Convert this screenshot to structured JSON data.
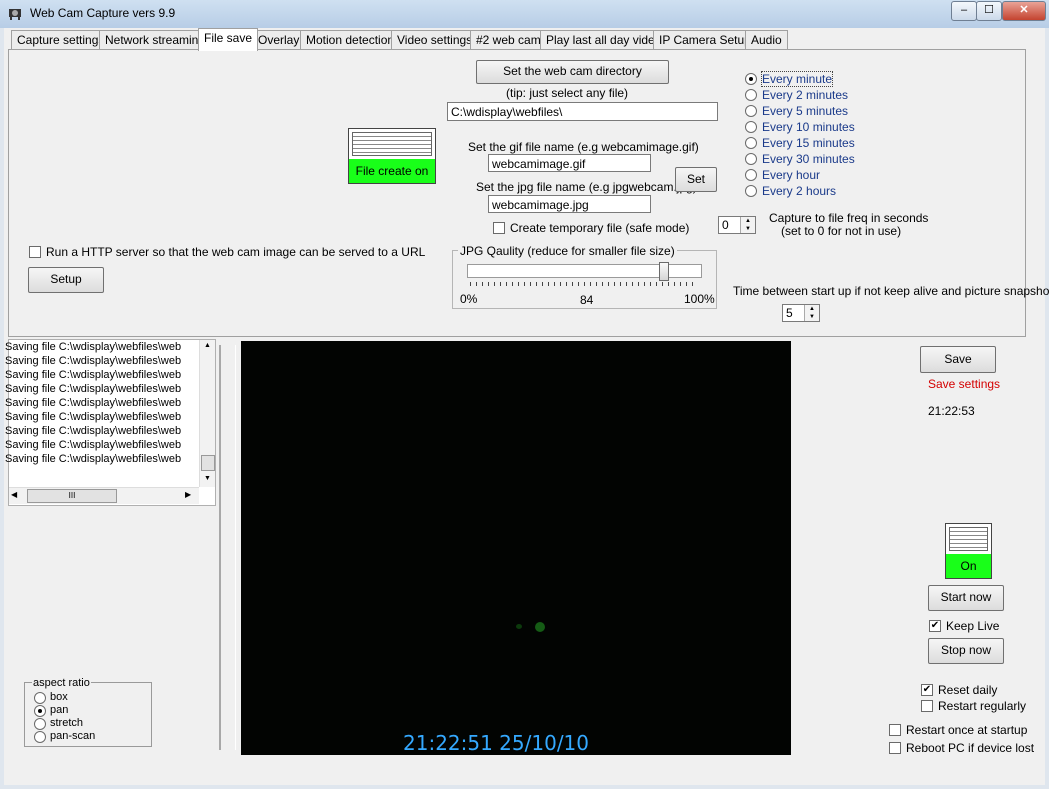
{
  "window": {
    "title": "Web Cam Capture vers 9.9",
    "controls": {
      "min": "–",
      "max": "☐",
      "close": "✕"
    }
  },
  "tabs": [
    {
      "label": "Capture settings"
    },
    {
      "label": "Network streaming"
    },
    {
      "label": "File save",
      "active": true
    },
    {
      "label": "Overlay"
    },
    {
      "label": "Motion detection"
    },
    {
      "label": "Video settings"
    },
    {
      "label": "#2 web cam"
    },
    {
      "label": "Play last all day video"
    },
    {
      "label": "IP Camera Setup"
    },
    {
      "label": "Audio"
    }
  ],
  "file_save": {
    "set_dir_button": "Set the web cam directory",
    "tip": "(tip: just select any file)",
    "directory": "C:\\wdisplay\\webfiles\\",
    "file_create_label": "File create on",
    "gif_label": "Set the gif file name (e.g webcamimage.gif)",
    "gif_value": "webcamimage.gif",
    "jpg_label": "Set the jpg file name (e.g jpgwebcam.jpg)",
    "jpg_value": "webcamimage.jpg",
    "set_button": "Set",
    "temp_file_label": "Create temporary file (safe mode)",
    "http_label": "Run a HTTP server so that the web cam image can be served to a URL",
    "setup_button": "Setup",
    "jpg_quality": {
      "legend": "JPG Qaulity  (reduce for smaller file size)",
      "min_label": "0%",
      "value_label": "84",
      "max_label": "100%",
      "value": 84
    },
    "frequency_options": [
      {
        "label": "Every minute",
        "selected": true
      },
      {
        "label": "Every 2 minutes",
        "selected": false
      },
      {
        "label": "Every 5 minutes",
        "selected": false
      },
      {
        "label": "Every 10 minutes",
        "selected": false
      },
      {
        "label": "Every 15 minutes",
        "selected": false
      },
      {
        "label": "Every 30 minutes",
        "selected": false
      },
      {
        "label": "Every hour",
        "selected": false
      },
      {
        "label": "Every 2 hours",
        "selected": false
      }
    ],
    "capture_freq_value": "0",
    "capture_freq_label": "Capture to file freq in seconds",
    "capture_freq_note": "(set to 0 for not in use)",
    "startup_label": "Time between start up if not keep alive and picture snapshot",
    "startup_value": "5"
  },
  "log": {
    "lines": [
      "Saving file C:\\wdisplay\\webfiles\\web",
      "Saving file C:\\wdisplay\\webfiles\\web",
      "Saving file C:\\wdisplay\\webfiles\\web",
      "Saving file C:\\wdisplay\\webfiles\\web",
      "Saving file C:\\wdisplay\\webfiles\\web",
      "Saving file C:\\wdisplay\\webfiles\\web",
      "Saving file C:\\wdisplay\\webfiles\\web",
      "Saving file C:\\wdisplay\\webfiles\\web",
      "Saving file C:\\wdisplay\\webfiles\\web"
    ],
    "hscroll_grip": "III"
  },
  "aspect": {
    "legend": "aspect ratio",
    "options": [
      {
        "label": "box",
        "selected": false
      },
      {
        "label": "pan",
        "selected": true
      },
      {
        "label": "stretch",
        "selected": false
      },
      {
        "label": "pan-scan",
        "selected": false
      }
    ]
  },
  "video": {
    "overlay_text": "21:22:51  25/10/10"
  },
  "right_panel": {
    "save_button": "Save",
    "save_settings": "Save settings",
    "clock": "21:22:53",
    "toggle_label": "On",
    "start_button": "Start now",
    "keep_live_label": "Keep Live",
    "keep_live_checked": true,
    "stop_button": "Stop now",
    "reset_daily_label": "Reset daily",
    "reset_daily_checked": true,
    "restart_regularly_label": "Restart regularly",
    "restart_once_label": "Restart once at startup",
    "reboot_label": "Reboot PC if device lost"
  },
  "colors": {
    "toggle_on": "#19ff19",
    "save_settings": "#d40000",
    "overlay_text": "#35a9ff",
    "video_bg": "#020402"
  }
}
